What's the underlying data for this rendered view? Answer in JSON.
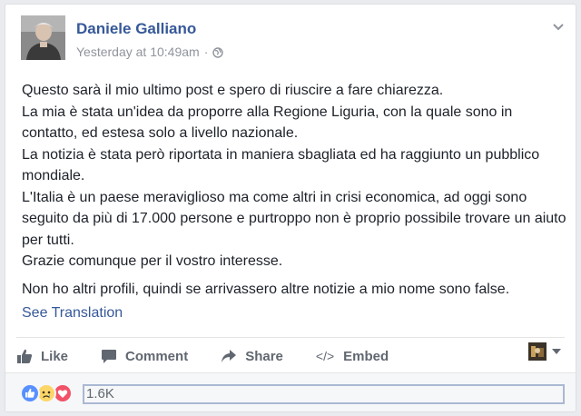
{
  "post": {
    "author": "Daniele Galliano",
    "timestamp": "Yesterday at 10:49am",
    "separator": "·",
    "privacy_icon": "globe-icon",
    "paragraphs": [
      "Questo sarà il mio ultimo post e spero di riuscire a fare chiarezza.",
      "La mia è stata un'idea da proporre alla Regione Liguria, con la quale sono in contatto, ed estesa solo a livello nazionale.",
      "La notizia è stata però riportata in maniera sbagliata ed ha raggiunto un pubblico mondiale.",
      "L'Italia è un paese meraviglioso ma come altri in crisi economica, ad oggi sono seguito da più di 17.000 persone e purtroppo non è proprio possibile trovare un aiuto per tutti.",
      "Grazie comunque per il vostro interesse."
    ],
    "final_paragraph": "Non ho altri profili, quindi se arrivassero altre notizie a mio nome sono false.",
    "see_translation": "See Translation"
  },
  "actions": {
    "like": "Like",
    "comment": "Comment",
    "share": "Share",
    "embed": "Embed",
    "embed_icon": "</>"
  },
  "reactions": {
    "icons": [
      "like-icon",
      "sad-icon",
      "love-icon"
    ],
    "count": "1.6K"
  },
  "colors": {
    "link": "#365899",
    "muted": "#90949c",
    "action_text": "#616770",
    "like_blue": "#5890ff",
    "love_red": "#f25268",
    "sad_yellow": "#fcd669"
  }
}
